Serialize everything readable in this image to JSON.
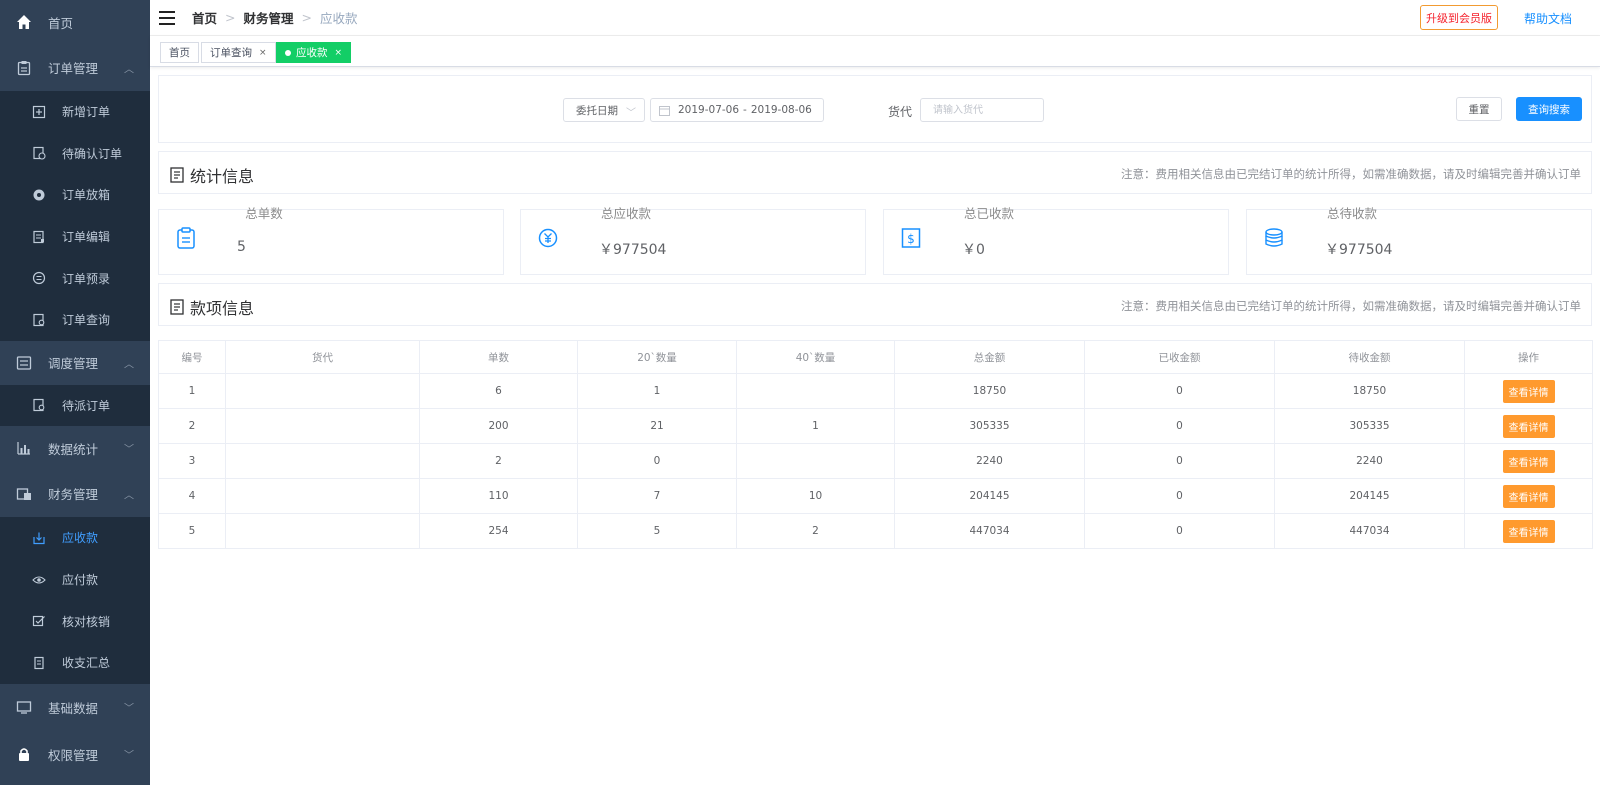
{
  "sidebar": {
    "home": "首页",
    "order_mgmt": "订单管理",
    "order_items": [
      "新增订单",
      "待确认订单",
      "订单放箱",
      "订单编辑",
      "订单预录",
      "订单查询"
    ],
    "dispatch_mgmt": "调度管理",
    "dispatch_items": [
      "待派订单"
    ],
    "data_stats": "数据统计",
    "finance_mgmt": "财务管理",
    "finance_items": [
      "应收款",
      "应付款",
      "核对核销",
      "收支汇总"
    ],
    "basic_data": "基础数据",
    "perm_mgmt": "权限管理"
  },
  "header": {
    "breadcrumb": [
      "首页",
      "财务管理",
      "应收款"
    ],
    "upgrade": "升级到会员版",
    "help": "帮助文档"
  },
  "tags": [
    "首页",
    "订单查询",
    "应收款"
  ],
  "search": {
    "date_type": "委托日期",
    "date_start": "2019-07-06",
    "date_end": "2019-08-06",
    "huodai_label": "货代",
    "huodai_placeholder": "请输入货代",
    "reset": "重置",
    "submit": "查询搜索"
  },
  "stats_section": {
    "title": "统计信息",
    "note": "注意：费用相关信息由已完结订单的统计所得，如需准确数据，请及时编辑完善并确认订单"
  },
  "stats": [
    {
      "label": "总单数",
      "value": "5"
    },
    {
      "label": "总应收款",
      "value": "￥977504"
    },
    {
      "label": "总已收款",
      "value": "￥0"
    },
    {
      "label": "总待收款",
      "value": "￥977504"
    }
  ],
  "payment_section": {
    "title": "款项信息",
    "note": "注意：费用相关信息由已完结订单的统计所得，如需准确数据，请及时编辑完善并确认订单"
  },
  "table": {
    "headers": [
      "编号",
      "货代",
      "单数",
      "20`数量",
      "40`数量",
      "总金额",
      "已收金额",
      "待收金额",
      "操作"
    ],
    "rows": [
      [
        "1",
        "",
        "6",
        "1",
        "",
        "18750",
        "0",
        "18750"
      ],
      [
        "2",
        "",
        "200",
        "21",
        "1",
        "305335",
        "0",
        "305335"
      ],
      [
        "3",
        "",
        "2",
        "0",
        "",
        "2240",
        "0",
        "2240"
      ],
      [
        "4",
        "",
        "110",
        "7",
        "10",
        "204145",
        "0",
        "204145"
      ],
      [
        "5",
        "",
        "254",
        "5",
        "2",
        "447034",
        "0",
        "447034"
      ]
    ],
    "action_label": "查看详情"
  }
}
